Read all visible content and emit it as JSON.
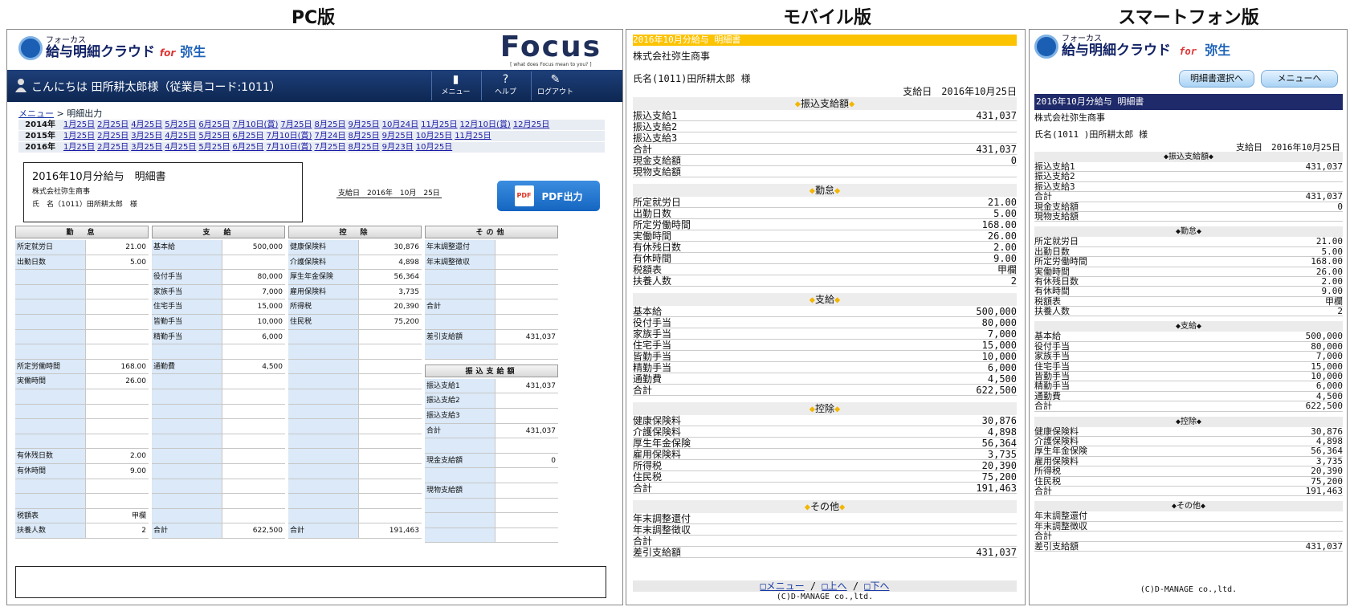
{
  "headings": {
    "pc": "PC版",
    "mobile": "モバイル版",
    "smart": "スマートフォン版"
  },
  "pc": {
    "logo_small": "フォーカス",
    "logo_main": "給与明細クラウド",
    "logo_for": "for",
    "logo_yayoi": "弥生",
    "focus_word": "Focus",
    "focus_sub": "[ what does Focus mean to you? ]",
    "greeting": "こんにちは 田所耕太郎様（従業員コード:1011）",
    "bar_buttons": [
      "メニュー",
      "ヘルプ",
      "ログアウト"
    ],
    "breadcrumb_link": "メニュー",
    "breadcrumb_current": "> 明細出力",
    "years": [
      {
        "year": "2014年",
        "links": [
          "1月25日",
          "2月25日",
          "4月25日",
          "5月25日",
          "6月25日",
          "7月10日(賞)",
          "7月25日",
          "8月25日",
          "9月25日",
          "10月24日",
          "11月25日",
          "12月10日(賞)",
          "12月25日"
        ]
      },
      {
        "year": "2015年",
        "links": [
          "1月25日",
          "2月25日",
          "3月25日",
          "4月25日",
          "5月25日",
          "6月25日",
          "7月10日(賞)",
          "7月24日",
          "8月25日",
          "9月25日",
          "10月25日",
          "11月25日"
        ]
      },
      {
        "year": "2016年",
        "links": [
          "1月25日",
          "2月25日",
          "3月25日",
          "4月25日",
          "5月25日",
          "6月25日",
          "7月10日(賞)",
          "7月25日",
          "8月25日",
          "9月23日",
          "10月25日"
        ]
      }
    ],
    "slip_title": "2016年10月分給与　明細書",
    "company": "株式会社弥生商事",
    "name": "氏　名（1011）田所耕太郎　様",
    "pay_date": "支給日　2016年　10月　25日",
    "pdf_label": "PDF出力",
    "pdf_icon": "PDF",
    "columns": [
      {
        "header": "勤　怠",
        "rows": [
          [
            "所定就労日",
            "21.00"
          ],
          [
            "出勤日数",
            "5.00"
          ],
          [
            "",
            ""
          ],
          [
            "",
            ""
          ],
          [
            "",
            ""
          ],
          [
            "",
            ""
          ],
          [
            "",
            ""
          ],
          [
            "",
            ""
          ],
          [
            "所定労働時間",
            "168.00"
          ],
          [
            "実働時間",
            "26.00"
          ],
          [
            "",
            ""
          ],
          [
            "",
            ""
          ],
          [
            "",
            ""
          ],
          [
            "",
            ""
          ],
          [
            "有休残日数",
            "2.00"
          ],
          [
            "有休時間",
            "9.00"
          ],
          [
            "",
            ""
          ],
          [
            "",
            ""
          ],
          [
            "税額表",
            "甲欄"
          ],
          [
            "扶養人数",
            "2"
          ]
        ]
      },
      {
        "header": "支　給",
        "rows": [
          [
            "基本給",
            "500,000"
          ],
          [
            "",
            ""
          ],
          [
            "役付手当",
            "80,000"
          ],
          [
            "家族手当",
            "7,000"
          ],
          [
            "住宅手当",
            "15,000"
          ],
          [
            "皆勤手当",
            "10,000"
          ],
          [
            "精勤手当",
            "6,000"
          ],
          [
            "",
            ""
          ],
          [
            "通勤費",
            "4,500"
          ],
          [
            "",
            ""
          ],
          [
            "",
            ""
          ],
          [
            "",
            ""
          ],
          [
            "",
            ""
          ],
          [
            "",
            ""
          ],
          [
            "",
            ""
          ],
          [
            "",
            ""
          ],
          [
            "",
            ""
          ],
          [
            "",
            ""
          ],
          [
            "",
            ""
          ],
          [
            "合計",
            "622,500"
          ]
        ]
      },
      {
        "header": "控　除",
        "rows": [
          [
            "健康保険料",
            "30,876"
          ],
          [
            "介護保険料",
            "4,898"
          ],
          [
            "厚生年金保険",
            "56,364"
          ],
          [
            "雇用保険料",
            "3,735"
          ],
          [
            "所得税",
            "20,390"
          ],
          [
            "住民税",
            "75,200"
          ],
          [
            "",
            ""
          ],
          [
            "",
            ""
          ],
          [
            "",
            ""
          ],
          [
            "",
            ""
          ],
          [
            "",
            ""
          ],
          [
            "",
            ""
          ],
          [
            "",
            ""
          ],
          [
            "",
            ""
          ],
          [
            "",
            ""
          ],
          [
            "",
            ""
          ],
          [
            "",
            ""
          ],
          [
            "",
            ""
          ],
          [
            "",
            ""
          ],
          [
            "合計",
            "191,463"
          ]
        ]
      },
      {
        "header": "その他",
        "rows": [
          [
            "年末調整還付",
            ""
          ],
          [
            "年末調整徴収",
            ""
          ],
          [
            "",
            ""
          ],
          [
            "",
            ""
          ],
          [
            "合計",
            ""
          ],
          [
            "",
            ""
          ],
          [
            "差引支給額",
            "431,037"
          ],
          [
            "",
            ""
          ]
        ],
        "header2": "振込支給額",
        "rows2": [
          [
            "振込支給1",
            "431,037"
          ],
          [
            "振込支給2",
            ""
          ],
          [
            "振込支給3",
            ""
          ],
          [
            "合計",
            "431,037"
          ],
          [
            "",
            ""
          ],
          [
            "現金支給額",
            "0"
          ],
          [
            "",
            ""
          ],
          [
            "現物支給額",
            ""
          ],
          [
            "",
            ""
          ],
          [
            "",
            ""
          ],
          [
            "",
            ""
          ]
        ]
      }
    ]
  },
  "mobile": {
    "title": "2016年10月分給与 明細書",
    "company": "株式会社弥生商事",
    "name": "氏名(1011)田所耕太郎 様",
    "pay_date": "支給日　2016年10月25日",
    "sections": [
      {
        "title": "振込支給額",
        "rows": [
          [
            "振込支給1",
            "431,037"
          ],
          [
            "振込支給2",
            ""
          ],
          [
            "振込支給3",
            ""
          ],
          [
            "合計",
            "431,037"
          ],
          [
            "現金支給額",
            "0"
          ],
          [
            "現物支給額",
            ""
          ]
        ]
      },
      {
        "title": "勤怠",
        "rows": [
          [
            "所定就労日",
            "21.00"
          ],
          [
            "出勤日数",
            "5.00"
          ],
          [
            "所定労働時間",
            "168.00"
          ],
          [
            "実働時間",
            "26.00"
          ],
          [
            "有休残日数",
            "2.00"
          ],
          [
            "有休時間",
            "9.00"
          ],
          [
            "税額表",
            "甲欄"
          ],
          [
            "扶養人数",
            "2"
          ]
        ]
      },
      {
        "title": "支給",
        "rows": [
          [
            "基本給",
            "500,000"
          ],
          [
            "役付手当",
            "80,000"
          ],
          [
            "家族手当",
            "7,000"
          ],
          [
            "住宅手当",
            "15,000"
          ],
          [
            "皆勤手当",
            "10,000"
          ],
          [
            "精勤手当",
            "6,000"
          ],
          [
            "通勤費",
            "4,500"
          ],
          [
            "合計",
            "622,500"
          ]
        ]
      },
      {
        "title": "控除",
        "rows": [
          [
            "健康保険料",
            "30,876"
          ],
          [
            "介護保険料",
            "4,898"
          ],
          [
            "厚生年金保険",
            "56,364"
          ],
          [
            "雇用保険料",
            "3,735"
          ],
          [
            "所得税",
            "20,390"
          ],
          [
            "住民税",
            "75,200"
          ],
          [
            "合計",
            "191,463"
          ]
        ]
      },
      {
        "title": "その他",
        "rows": [
          [
            "年末調整還付",
            ""
          ],
          [
            "年末調整徴収",
            ""
          ],
          [
            "合計",
            ""
          ],
          [
            "差引支給額",
            "431,037"
          ]
        ]
      }
    ],
    "nav": [
      "□メニュー",
      "□上へ",
      "□下へ"
    ],
    "copyright": "(C)D-MANAGE co.,ltd."
  },
  "smart": {
    "logo_small": "フォーカス",
    "logo_main": "給与明細クラウド",
    "logo_for": "for",
    "logo_yayoi": "弥生",
    "btn_select": "明細書選択へ",
    "btn_menu": "メニューへ",
    "title": "2016年10月分給与 明細書",
    "company": "株式会社弥生商事",
    "name": "氏名(1011 )田所耕太郎 様",
    "pay_date": "支給日　2016年10月25日",
    "sections": [
      {
        "title": "◆振込支給額◆",
        "rows": [
          [
            "振込支給1",
            "431,037"
          ],
          [
            "振込支給2",
            ""
          ],
          [
            "振込支給3",
            ""
          ],
          [
            "合計",
            "431,037"
          ],
          [
            "現金支給額",
            "0"
          ],
          [
            "現物支給額",
            ""
          ]
        ]
      },
      {
        "title": "◆勤怠◆",
        "rows": [
          [
            "所定就労日",
            "21.00"
          ],
          [
            "出勤日数",
            "5.00"
          ],
          [
            "所定労働時間",
            "168.00"
          ],
          [
            "実働時間",
            "26.00"
          ],
          [
            "有休残日数",
            "2.00"
          ],
          [
            "有休時間",
            "9.00"
          ],
          [
            "税額表",
            "甲欄"
          ],
          [
            "扶養人数",
            "2"
          ]
        ]
      },
      {
        "title": "◆支給◆",
        "rows": [
          [
            "基本給",
            "500,000"
          ],
          [
            "役付手当",
            "80,000"
          ],
          [
            "家族手当",
            "7,000"
          ],
          [
            "住宅手当",
            "15,000"
          ],
          [
            "皆勤手当",
            "10,000"
          ],
          [
            "精勤手当",
            "6,000"
          ],
          [
            "通勤費",
            "4,500"
          ],
          [
            "合計",
            "622,500"
          ]
        ]
      },
      {
        "title": "◆控除◆",
        "rows": [
          [
            "健康保険料",
            "30,876"
          ],
          [
            "介護保険料",
            "4,898"
          ],
          [
            "厚生年金保険",
            "56,364"
          ],
          [
            "雇用保険料",
            "3,735"
          ],
          [
            "所得税",
            "20,390"
          ],
          [
            "住民税",
            "75,200"
          ],
          [
            "合計",
            "191,463"
          ]
        ]
      },
      {
        "title": "◆その他◆",
        "rows": [
          [
            "年末調整還付",
            ""
          ],
          [
            "年末調整徴収",
            ""
          ],
          [
            "合計",
            ""
          ],
          [
            "差引支給額",
            "431,037"
          ]
        ]
      }
    ],
    "copyright": "(C)D-MANAGE co.,ltd."
  }
}
